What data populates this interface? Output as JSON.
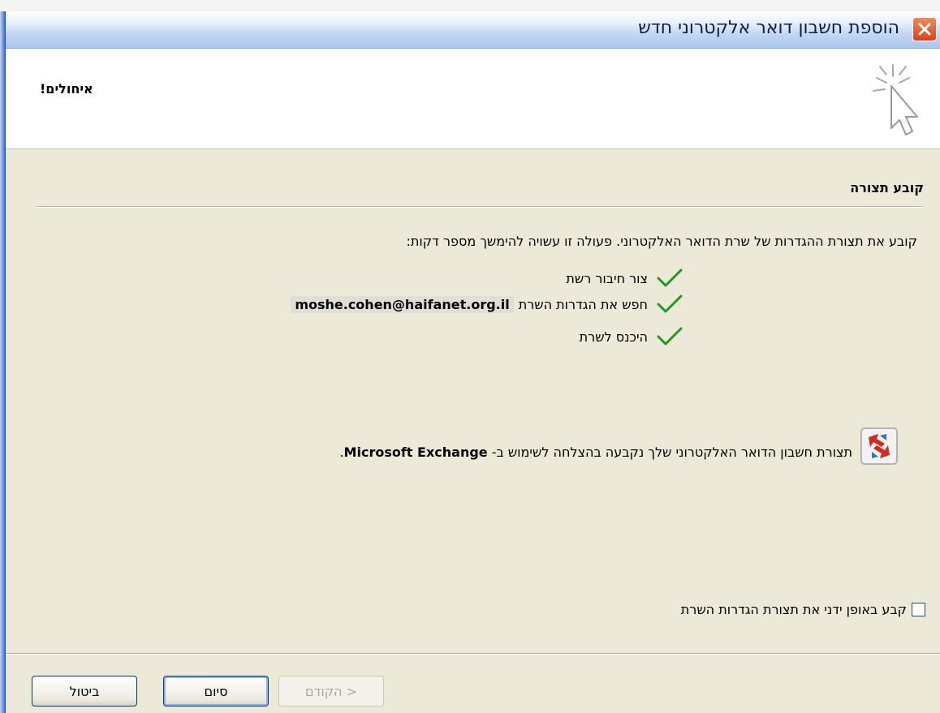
{
  "window": {
    "title": "הוספת חשבון דואר אלקטרוני חדש"
  },
  "header": {
    "title": "איחולים!"
  },
  "section": {
    "title": "קובע תצורה",
    "intro": "קובע את תצורת ההגדרות של שרת הדואר האלקטרוני. פעולה זו עשויה להימשך מספר דקות:"
  },
  "steps": [
    {
      "label": "צור חיבור רשת",
      "status": "done"
    },
    {
      "label": "חפש את הגדרות השרת",
      "email": "moshe.cohen@haifanet.org.il",
      "status": "done"
    },
    {
      "label": "היכנס לשרת",
      "status": "done"
    }
  ],
  "result": {
    "text": "תצורת חשבון הדואר האלקטרוני שלך נקבעה בהצלחה לשימוש ב-",
    "product": "Microsoft Exchange",
    "suffix": "."
  },
  "manual_config": {
    "label": "קבע באופן ידני את תצורת הגדרות השרת",
    "checked": false
  },
  "buttons": {
    "back": "< הקודם",
    "finish": "סיום",
    "cancel": "ביטול"
  },
  "colors": {
    "window_bg": "#ece9d8",
    "check_green": "#1f9a1f",
    "close_red": "#d8421a"
  }
}
